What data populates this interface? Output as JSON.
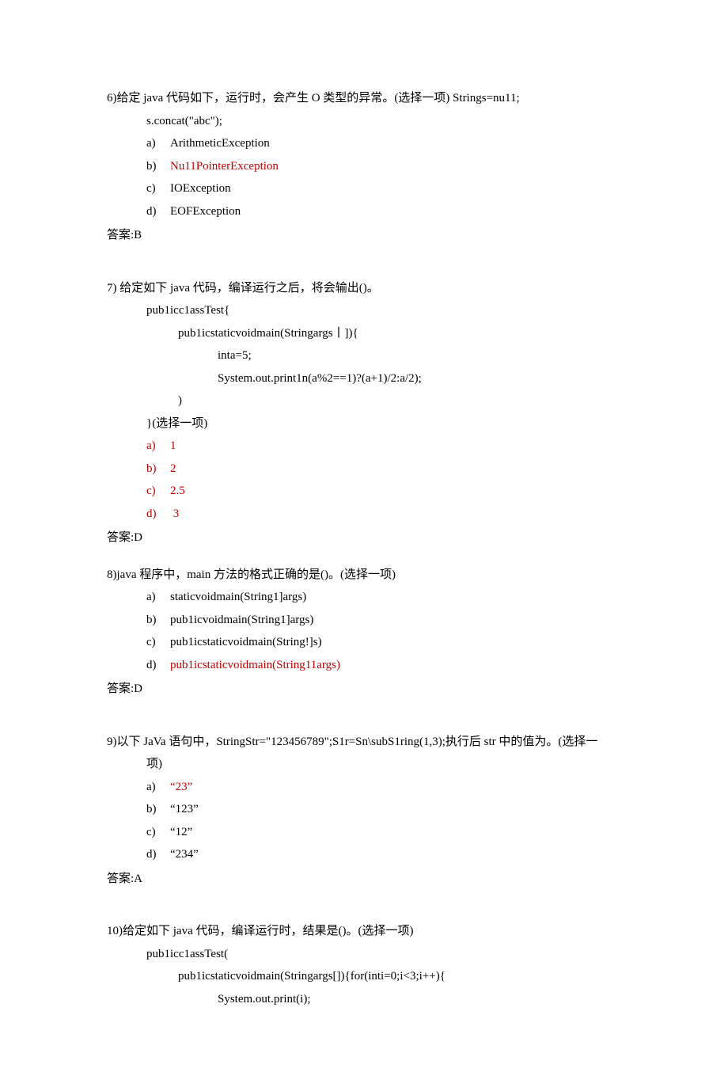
{
  "q6": {
    "head": "6)给定 java 代码如下，运行时，会产生 O 类型的异常。(选择一项) Strings=nu11;",
    "code1": "s.concat(\"abc\");",
    "a_l": "a)",
    "a_t": "ArithmeticException",
    "b_l": "b)",
    "b_t": "Nu11PointerException",
    "c_l": "c)",
    "c_t": "IOException",
    "d_l": "d)",
    "d_t": "EOFException",
    "ans": "答案:B"
  },
  "q7": {
    "head": "7)    给定如下 java 代码，编译运行之后，将会输出()。",
    "c1": "pub1icc1assTest{",
    "c2": "pub1icstaticvoidmain(Stringargs丨]){",
    "c3": "inta=5;",
    "c4": "System.out.print1n(a%2==1)?(a+1)/2:a/2);",
    "c5": ")",
    "c6": "}(选择一项)",
    "a_l": "a)",
    "a_t": "1",
    "b_l": "b)",
    "b_t": "2",
    "c_l": "c)",
    "c_t": "2.5",
    "d_l": "d)",
    "d_t": " 3",
    "ans": "答案:D"
  },
  "q8": {
    "head": "8)java 程序中，main 方法的格式正确的是()。(选择一项)",
    "a_l": "a)",
    "a_t": "staticvoidmain(String1]args)",
    "b_l": "b)",
    "b_t": "pub1icvoidmain(String1]args)",
    "c_l": "c)",
    "c_t": "pub1icstaticvoidmain(String!]s)",
    "d_l": "d)",
    "d_t": "pub1icstaticvoidmain(String11args)",
    "ans": "答案:D"
  },
  "q9": {
    "head": "9)以下 JaVa 语句中，StringStr=\"123456789\";S1r=Sn\\subS1ring(1,3);执行后 str 中的值为。(选择一",
    "cont": "项)",
    "a_l": "a)",
    "a_t": "“23”",
    "b_l": "b)",
    "b_t": "“123”",
    "c_l": "c)",
    "c_t": "“12”",
    "d_l": "d)",
    "d_t": "“234”",
    "ans": "答案:A"
  },
  "q10": {
    "head": "10)给定如下 java 代码，编译运行时，结果是()。(选择一项)",
    "c1": "pub1icc1assTest(",
    "c2": "pub1icstaticvoidmain(Stringargs[]){for(inti=0;i<3;i++){",
    "c3": "System.out.print(i);"
  }
}
